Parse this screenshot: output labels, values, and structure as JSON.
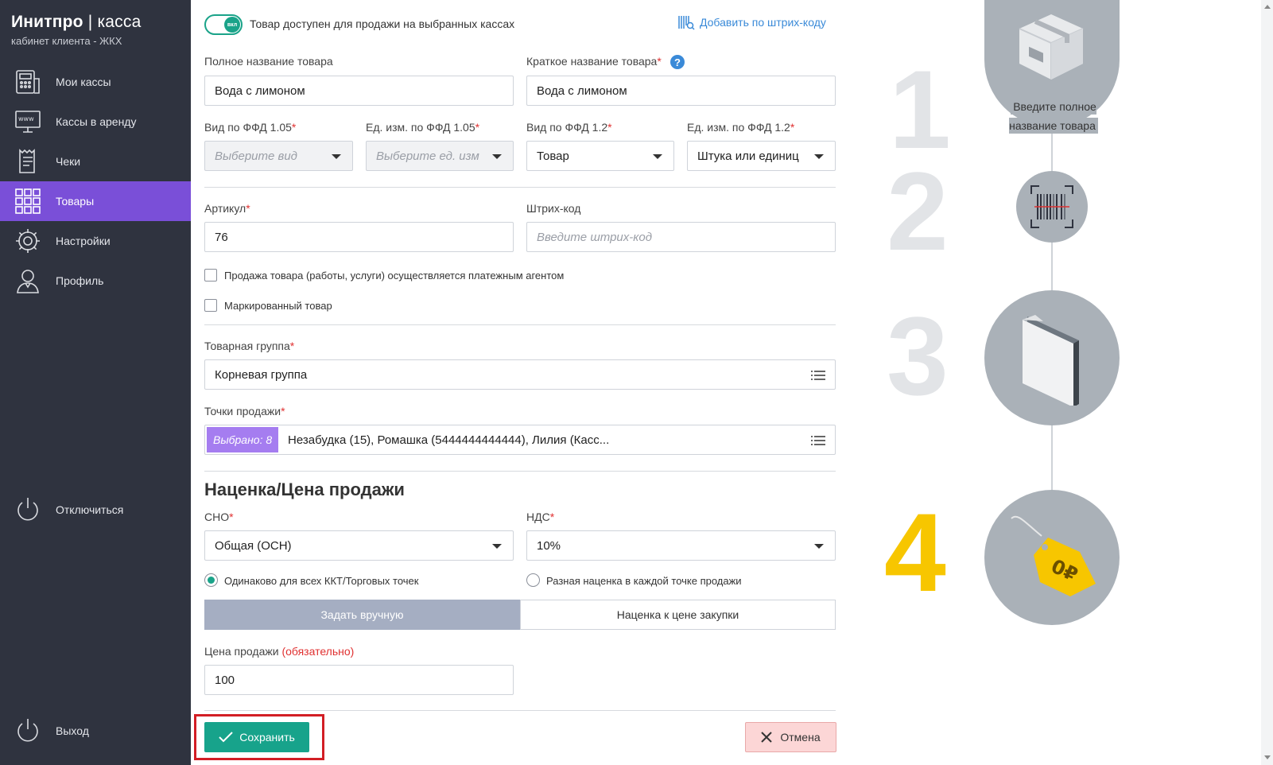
{
  "brand": {
    "name_bold": "Инитпро",
    "separator": " | ",
    "name_light": "касса",
    "subtitle": "кабинет клиента - ЖКХ"
  },
  "sidebar": {
    "items": [
      {
        "label": "Мои кассы",
        "icon": "cash-register-icon"
      },
      {
        "label": "Кассы в аренду",
        "icon": "www-icon"
      },
      {
        "label": "Чеки",
        "icon": "receipt-icon"
      },
      {
        "label": "Товары",
        "icon": "grid-icon",
        "active": true
      },
      {
        "label": "Настройки",
        "icon": "gear-icon"
      },
      {
        "label": "Профиль",
        "icon": "user-icon"
      }
    ],
    "disconnect": "Отключиться",
    "logout": "Выход"
  },
  "form": {
    "toggle_knob": "вкл",
    "toggle_label": "Товар доступен для продажи на выбранных кассах",
    "barcode_link": "Добавить по штрих-коду",
    "full_name_label": "Полное название товара",
    "full_name_value": "Вода с лимоном",
    "short_name_label": "Краткое название товара",
    "short_name_value": "Вода с лимоном",
    "help": "?",
    "ffd105_type_label": "Вид по ФФД 1.05",
    "ffd105_type_placeholder": "Выберите вид",
    "ffd105_unit_label": "Ед. изм. по ФФД 1.05",
    "ffd105_unit_placeholder": "Выберите ед. изм",
    "ffd12_type_label": "Вид по ФФД 1.2",
    "ffd12_type_value": "Товар",
    "ffd12_unit_label": "Ед. изм. по ФФД 1.2",
    "ffd12_unit_value": "Штука или единиц",
    "article_label": "Артикул",
    "article_value": "76",
    "barcode_label": "Штрих-код",
    "barcode_placeholder": "Введите штрих-код",
    "agent_checkbox": "Продажа товара (работы, услуги) осуществляется платежным агентом",
    "marked_checkbox": "Маркированный товар",
    "group_label": "Товарная группа",
    "group_value": "Корневая группа",
    "points_label": "Точки продажи",
    "points_badge": "Выбрано: 8",
    "points_value": "Незабудка (15), Ромашка (5444444444444), Лилия (Касс...",
    "pricing_title": "Наценка/Цена продажи",
    "sno_label": "СНО",
    "sno_value": "Общая (ОСН)",
    "vat_label": "НДС",
    "vat_value": "10%",
    "radio_same": "Одинаково для всех ККТ/Торговых точек",
    "radio_diff": "Разная наценка в каждой точке продажи",
    "tab_manual": "Задать вручную",
    "tab_markup": "Наценка к цене закупки",
    "price_label": "Цена продажи",
    "price_required": "(обязательно)",
    "price_value": "100",
    "save": "Сохранить",
    "cancel": "Отмена",
    "required_mark": "*"
  },
  "steps": {
    "numbers": [
      "1",
      "2",
      "3",
      "4"
    ],
    "active_step": "4",
    "tip": "Введите полное название товара",
    "price_tag": "0₽"
  },
  "colors": {
    "sidebar": "#2f333f",
    "active": "#7a4fd8",
    "accent": "#17a38b",
    "step_active": "#f7c600"
  }
}
